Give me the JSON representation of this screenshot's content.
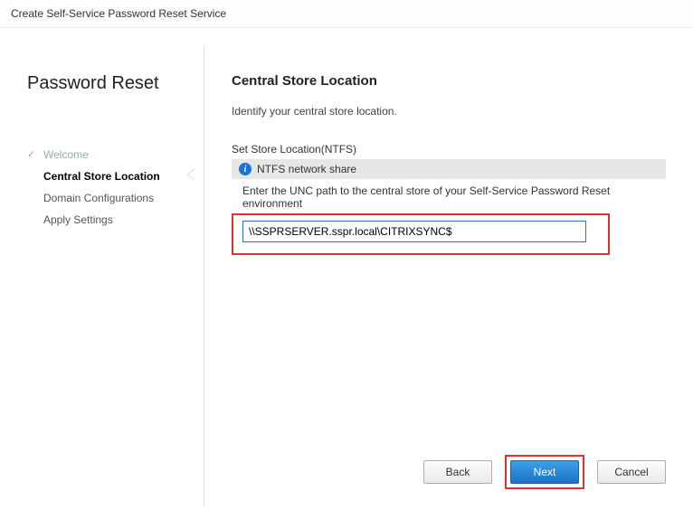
{
  "titlebar": "Create Self-Service Password Reset Service",
  "sidebar": {
    "title": "Password Reset",
    "steps": [
      {
        "label": "Welcome",
        "state": "done"
      },
      {
        "label": "Central Store Location",
        "state": "current"
      },
      {
        "label": "Domain Configurations",
        "state": "future"
      },
      {
        "label": "Apply Settings",
        "state": "future"
      }
    ]
  },
  "content": {
    "heading": "Central Store Location",
    "description": "Identify your central store location.",
    "section_label": "Set Store Location(NTFS)",
    "ntfs_label": "NTFS network share",
    "hint": "Enter the UNC path to the central store of your Self-Service Password Reset environment",
    "path_value": "\\\\SSPRSERVER.sspr.local\\CITRIXSYNC$"
  },
  "buttons": {
    "back": "Back",
    "next": "Next",
    "cancel": "Cancel"
  }
}
